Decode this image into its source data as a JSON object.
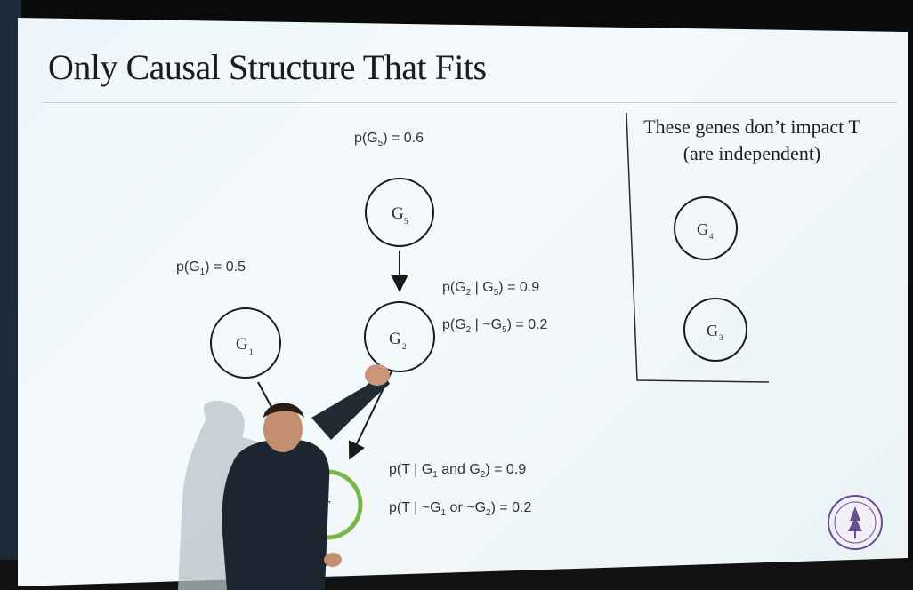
{
  "slide": {
    "title": "Only Causal Structure That Fits",
    "side_title_line1": "These genes don’t impact T",
    "side_title_line2": "(are independent)"
  },
  "nodes": {
    "g5": {
      "label": "G",
      "sub": "5"
    },
    "g1": {
      "label": "G",
      "sub": "1"
    },
    "g2": {
      "label": "G",
      "sub": "2"
    },
    "t": {
      "label": "T"
    },
    "g4": {
      "label": "G",
      "sub": "4"
    },
    "g3": {
      "label": "G",
      "sub": "3"
    }
  },
  "probabilities": {
    "p_g5": {
      "pre": "p(G",
      "sub": "5",
      "post": ") = 0.6"
    },
    "p_g1": {
      "pre": "p(G",
      "sub": "1",
      "post": ") = 0.5"
    },
    "p_g2_given_g5": {
      "pre": "p(G",
      "sub": "2",
      "mid": " | G",
      "sub2": "5",
      "post": ") = 0.9"
    },
    "p_g2_given_not_g5": {
      "pre": "p(G",
      "sub": "2",
      "mid": " | ~G",
      "sub2": "5",
      "post": ") = 0.2"
    },
    "p_t_given_g1_and_g2": {
      "pre": "p(T | G",
      "sub": "1",
      "mid": " and G",
      "sub2": "2",
      "post": ") = 0.9"
    },
    "p_t_given_not": {
      "pre": "p(T | ~G",
      "sub": "1",
      "mid": " or ~G",
      "sub2": "2",
      "post": ") = 0.2"
    }
  },
  "colors": {
    "t_node_ring": "#7ab648",
    "node_ring": "#1a1a1a"
  }
}
